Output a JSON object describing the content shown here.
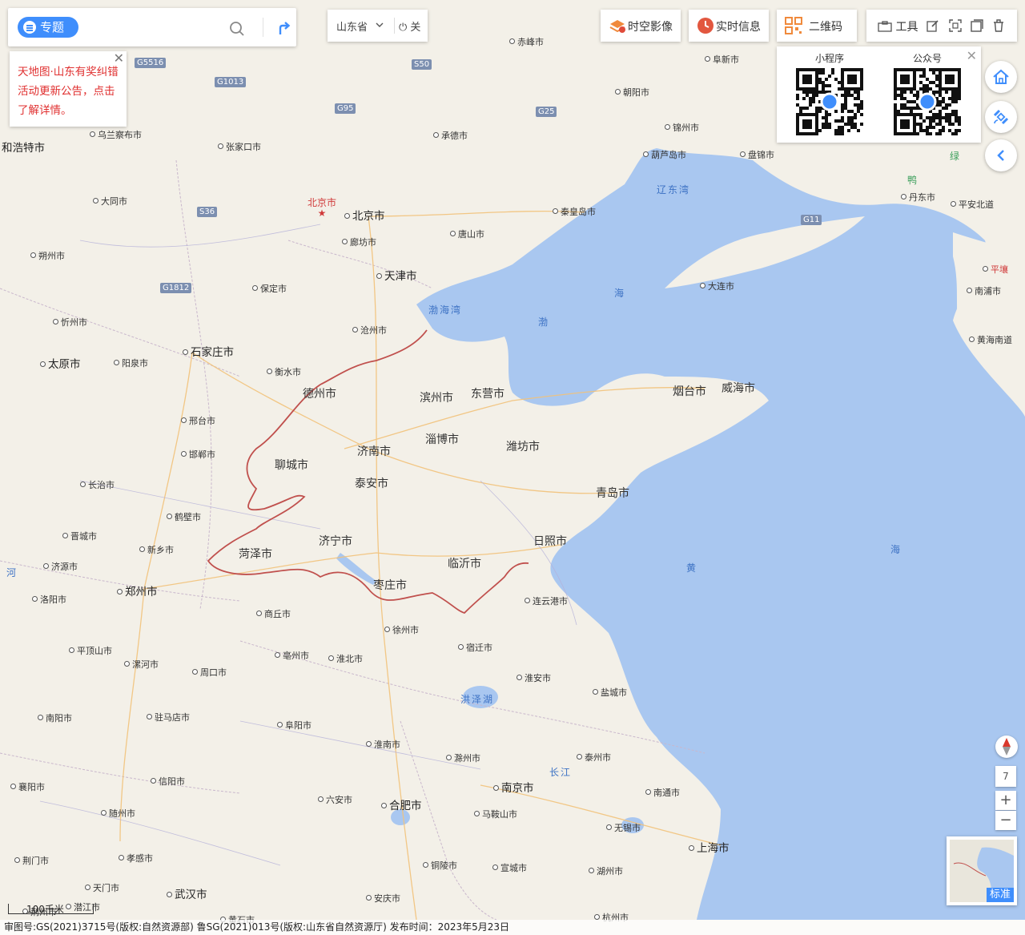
{
  "search": {
    "topic_label": "专题",
    "placeholder": ""
  },
  "notice": {
    "text": "天地图·山东有奖纠错活动更新公告，点击了解详情。",
    "close": "✕"
  },
  "region": {
    "name": "山东省",
    "off_label": "关"
  },
  "toolbar": {
    "imagery_label": "时空影像",
    "realtime_label": "实时信息",
    "qrcode_label": "二维码",
    "tools_label": "工具"
  },
  "qr_popup": {
    "mini_program_label": "小程序",
    "official_account_label": "公众号",
    "close": "✕"
  },
  "zoom": {
    "level": "7",
    "in": "+",
    "out": "−"
  },
  "minimap": {
    "label": "标准"
  },
  "scale": {
    "label": "100千米"
  },
  "footer": {
    "text": "审图号:GS(2021)3715号(版权:自然资源部) 鲁SG(2021)013号(版权:山东省自然资源厅) 发布时间：2023年5月23日"
  },
  "map": {
    "capital": "北京市",
    "cities_big": [
      "北京市",
      "天津市",
      "石家庄市",
      "太原市",
      "郑州市",
      "合肥市",
      "南京市",
      "上海市",
      "武汉市",
      "和浩特市"
    ],
    "cities_shandong": [
      "德州市",
      "滨州市",
      "东营市",
      "淄博市",
      "济南市",
      "聊城市",
      "泰安市",
      "潍坊市",
      "烟台市",
      "威海市",
      "青岛市",
      "日照市",
      "临沂市",
      "济宁市",
      "菏泽市",
      "枣庄市"
    ],
    "cities_small": [
      "赤峰市",
      "阜新市",
      "朝阳市",
      "锦州市",
      "承德市",
      "葫芦岛市",
      "盘锦市",
      "乌兰察布市",
      "张家口市",
      "大同市",
      "秦皇岛市",
      "丹东市",
      "平安北道",
      "唐山市",
      "廊坊市",
      "朔州市",
      "保定市",
      "大连市",
      "南浦市",
      "沧州市",
      "忻州市",
      "衡水市",
      "阳泉市",
      "黄海南道",
      "邢台市",
      "邯郸市",
      "长治市",
      "鹤壁市",
      "晋城市",
      "新乡市",
      "济源市",
      "洛阳市",
      "连云港市",
      "商丘市",
      "徐州市",
      "平顶山市",
      "宿迁市",
      "漯河市",
      "周口市",
      "亳州市",
      "淮北市",
      "淮安市",
      "盐城市",
      "南阳市",
      "驻马店市",
      "阜阳市",
      "淮南市",
      "泰州市",
      "滁州市",
      "襄阳市",
      "信阳市",
      "南通市",
      "随州市",
      "六安市",
      "马鞍山市",
      "无锡市",
      "荆门市",
      "孝感市",
      "铜陵市",
      "宣城市",
      "湖州市",
      "天门市",
      "潜江市",
      "安庆市",
      "杭州市",
      "荆州市",
      "黄石市",
      "平壤"
    ],
    "seas": [
      "辽东湾",
      "渤海湾",
      "渤",
      "海",
      "黄",
      "海",
      "洪泽湖",
      "长江",
      "绿",
      "鸭",
      "河"
    ],
    "highways": [
      "G5516",
      "G1013",
      "S50",
      "G95",
      "G25",
      "S36",
      "G1812",
      "G11",
      "G1013"
    ]
  },
  "colors": {
    "accent": "#3f8efc",
    "sea": "#a9c7f0",
    "land": "#f3f0e8",
    "boundary": "#c0504d",
    "notice_text": "#e03030"
  }
}
